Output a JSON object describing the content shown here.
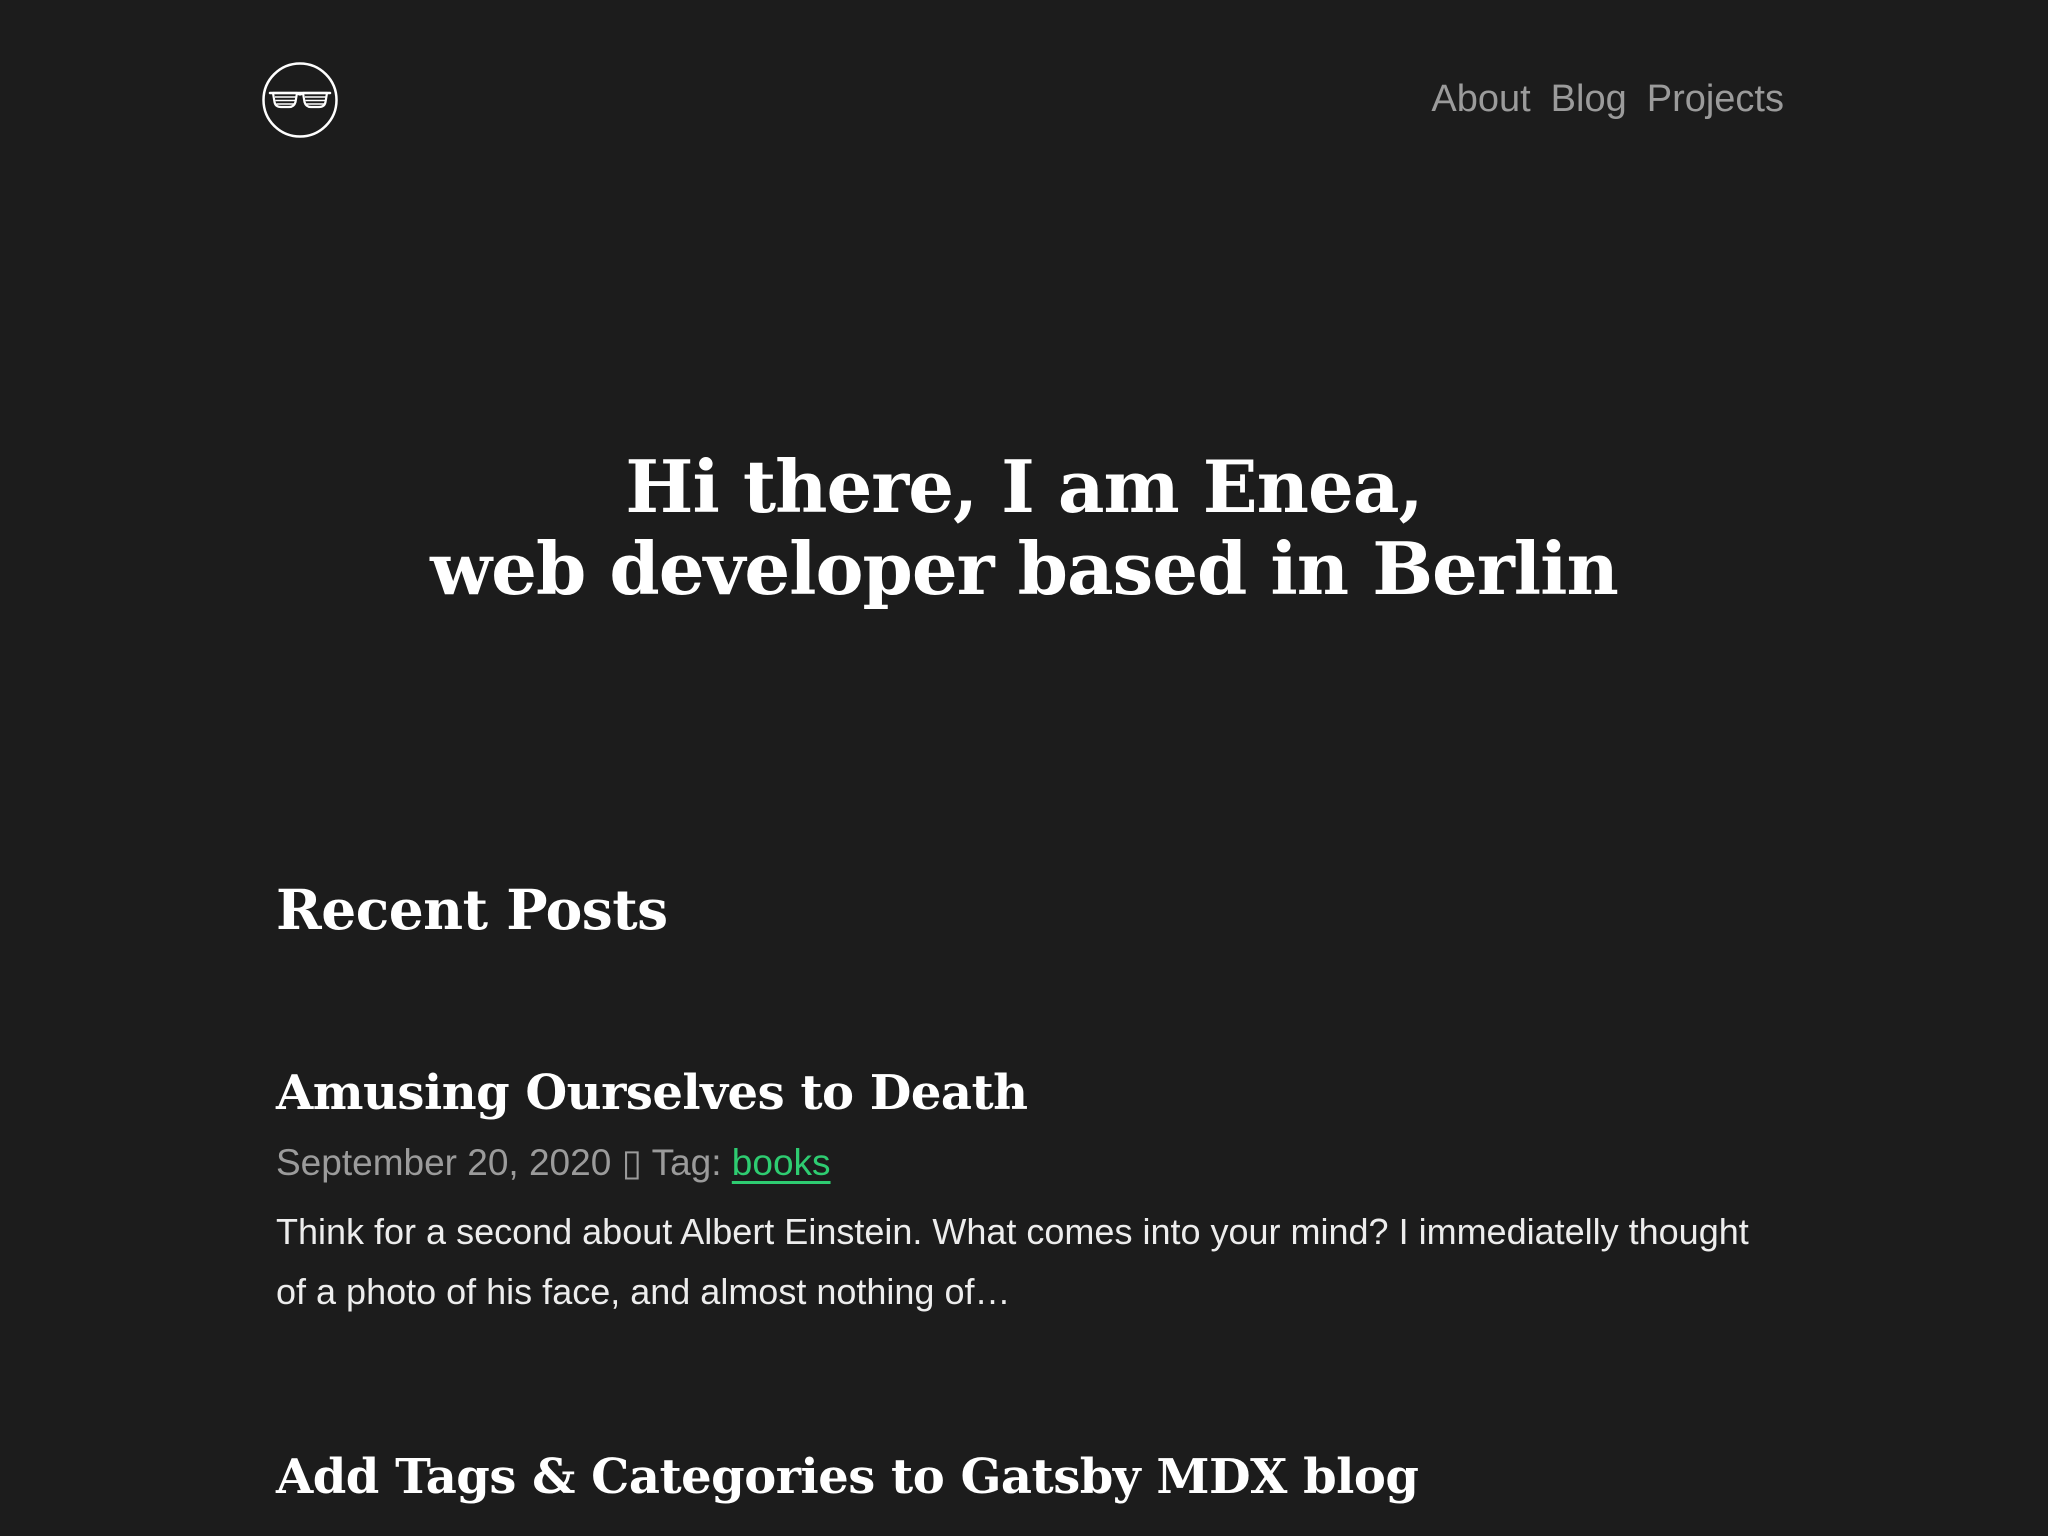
{
  "header": {
    "logo_alt": "sunglasses logo",
    "nav": [
      {
        "label": "About"
      },
      {
        "label": "Blog"
      },
      {
        "label": "Projects"
      }
    ]
  },
  "hero": {
    "line1": "Hi there, I am Enea,",
    "line2": "web developer based in Berlin"
  },
  "recent_posts": {
    "heading": "Recent Posts",
    "posts": [
      {
        "title": "Amusing Ourselves to Death",
        "date": "September 20, 2020",
        "separator": "▯",
        "tag_label": "Tag:",
        "tag": "books",
        "excerpt": "Think for a second about Albert Einstein. What comes into your mind? I immediatelly thought of a photo of his face, and almost nothing of…"
      },
      {
        "title": "Add Tags & Categories to Gatsby MDX blog"
      }
    ]
  },
  "colors": {
    "background": "#1c1c1c",
    "text": "#ffffff",
    "muted": "#9b9b9b",
    "accent": "#2ecc71"
  }
}
